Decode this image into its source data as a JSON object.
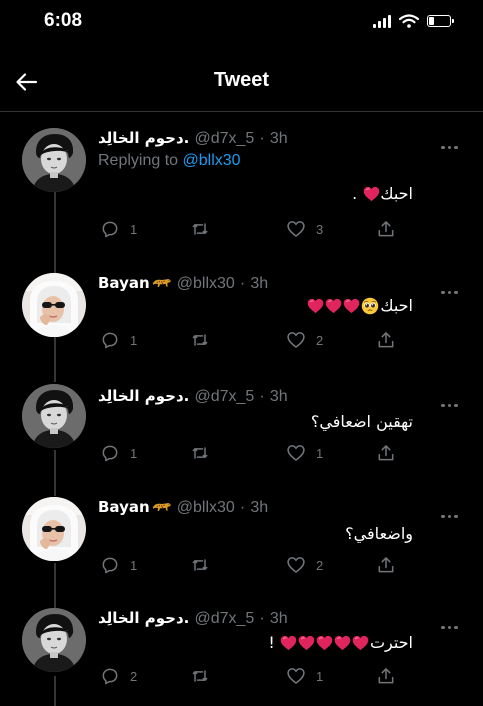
{
  "status_bar": {
    "time": "6:08"
  },
  "header": {
    "title": "Tweet"
  },
  "tweets": [
    {
      "name": "دحوم الخالِد.",
      "handle": "@d7x_5",
      "sep": "·",
      "time": "3h",
      "replying_prefix": "Replying to ",
      "replying_mention": "@bllx30",
      "text": "احبك",
      "text_suffix": ".",
      "replies": "1",
      "likes": "3"
    },
    {
      "name": "Bayan",
      "handle": "@bllx30",
      "sep": "·",
      "time": "3h",
      "text": "احبك",
      "replies": "1",
      "likes": "2"
    },
    {
      "name": "دحوم الخالِد.",
      "handle": "@d7x_5",
      "sep": "·",
      "time": "3h",
      "text": "تهقين اضعافي؟",
      "replies": "1",
      "likes": "1"
    },
    {
      "name": "Bayan",
      "handle": "@bllx30",
      "sep": "·",
      "time": "3h",
      "text": "واضعافي؟",
      "replies": "1",
      "likes": "2"
    },
    {
      "name": "دحوم الخالِد.",
      "handle": "@d7x_5",
      "sep": "·",
      "time": "3h",
      "text": "احترت",
      "text_suffix": "!",
      "replies": "2",
      "likes": "1"
    }
  ],
  "icons": {
    "back": "arrow-left-icon",
    "more": "more-dots-icon",
    "reply": "reply-icon",
    "retweet": "retweet-icon",
    "like": "heart-outline-icon",
    "share": "share-icon",
    "heart_emoji": "red-heart-icon",
    "pleading_emoji": "pleading-face-icon",
    "leopard_emoji": "leopard-icon"
  },
  "colors": {
    "background": "#000000",
    "link": "#1d9bf0",
    "secondary": "#71767b",
    "heart": "#e0245e"
  }
}
